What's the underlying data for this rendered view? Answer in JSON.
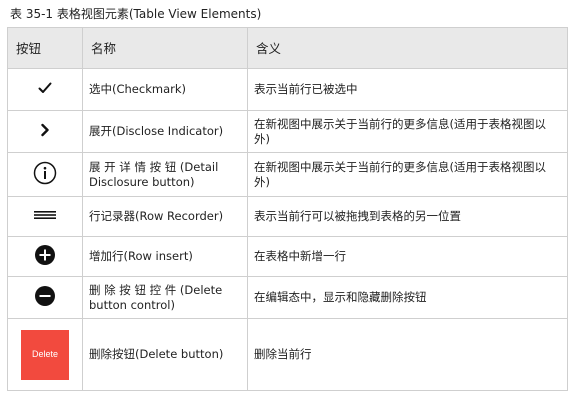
{
  "caption": "表 35-1  表格视图元素(Table View Elements)",
  "table": {
    "headers": [
      "按钮",
      "名称",
      "含义"
    ],
    "rows": [
      {
        "icon": "checkmark-icon",
        "name": "选中(Checkmark)",
        "meaning": "表示当前行已被选中"
      },
      {
        "icon": "chevron-right-icon",
        "name": "展开(Disclose Indicator)",
        "meaning": "在新视图中展示关于当前行的更多信息(适用于表格视图以外)"
      },
      {
        "icon": "info-circle-icon",
        "name": "展 开 详 情 按 钮 (Detail Disclosure button)",
        "meaning": "在新视图中展示关于当前行的更多信息(适用于表格视图以外)"
      },
      {
        "icon": "reorder-handle-icon",
        "name": "行记录器(Row Recorder)",
        "meaning": "表示当前行可以被拖拽到表格的另一位置"
      },
      {
        "icon": "plus-circle-icon",
        "name": "增加行(Row insert)",
        "meaning": "在表格中新增一行"
      },
      {
        "icon": "minus-circle-icon",
        "name": "删 除 按 钮 控 件 (Delete button control)",
        "meaning": "在编辑态中，显示和隐藏删除按钮"
      },
      {
        "icon": "delete-button-icon",
        "icon_label": "Delete",
        "name": "删除按钮(Delete button)",
        "meaning": "删除当前行"
      }
    ]
  },
  "colors": {
    "header_bg": "#e9e9e9",
    "border": "#cfcfcf",
    "delete_red": "#f24a3e"
  }
}
